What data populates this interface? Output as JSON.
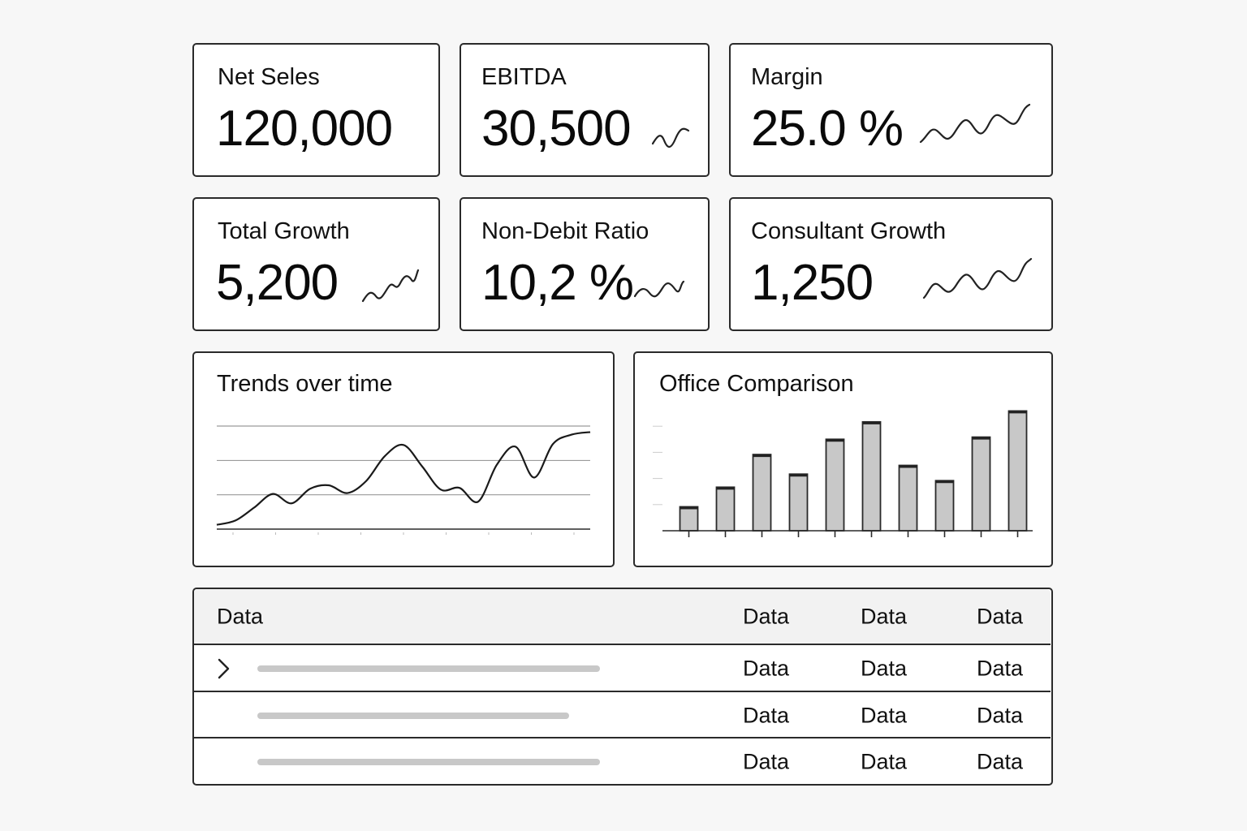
{
  "kpis": [
    {
      "label": "Net Seles",
      "value": "120,000",
      "sparkline": false
    },
    {
      "label": "EBITDA",
      "value": "30,500",
      "sparkline": true
    },
    {
      "label": "Margin",
      "value": "25.0 %",
      "sparkline": true
    },
    {
      "label": "Total Growth",
      "value": "5,200",
      "sparkline": true
    },
    {
      "label": "Non-Debit Ratio",
      "value": "10,2 %",
      "sparkline": true
    },
    {
      "label": "Consultant Growth",
      "value": "1,250",
      "sparkline": true
    }
  ],
  "panels": {
    "trends_title": "Trends over time",
    "office_title": "Office Comparison"
  },
  "chart_data": [
    {
      "type": "line",
      "title": "Trends over time",
      "x": [
        0,
        1,
        2,
        3,
        4,
        5,
        6,
        7,
        8,
        9,
        10,
        11,
        12,
        13,
        14,
        15,
        16,
        17,
        18,
        19,
        20
      ],
      "series": [
        {
          "values": [
            0.5,
            1.0,
            2.5,
            4.1,
            3.0,
            4.7,
            5.1,
            4.2,
            5.6,
            8.5,
            9.8,
            7.3,
            4.6,
            4.8,
            3.2,
            7.5,
            9.6,
            6.0,
            9.9,
            11.0,
            11.3
          ]
        }
      ],
      "ylim": [
        0,
        12
      ],
      "grid": true,
      "xlabel": "",
      "ylabel": ""
    },
    {
      "type": "bar",
      "title": "Office Comparison",
      "categories": [
        "",
        "",
        "",
        "",
        "",
        "",
        "",
        "",
        "",
        ""
      ],
      "values": [
        22,
        40,
        70,
        52,
        84,
        100,
        60,
        46,
        86,
        110
      ],
      "ylim": [
        0,
        120
      ],
      "bar_color": "#c8c8c8",
      "xlabel": "",
      "ylabel": ""
    }
  ],
  "table": {
    "headers": [
      "Data",
      "Data",
      "Data",
      "Data"
    ],
    "rows": [
      {
        "expandable": true,
        "bar_fraction": 1.0,
        "cells": [
          "Data",
          "Data",
          "Data"
        ]
      },
      {
        "expandable": false,
        "bar_fraction": 0.91,
        "cells": [
          "Data",
          "Data",
          "Data"
        ]
      },
      {
        "expandable": false,
        "bar_fraction": 1.0,
        "cells": [
          "Data",
          "Data",
          "Data"
        ]
      }
    ],
    "icons": {
      "expand": "chevron-right-icon"
    }
  },
  "colors": {
    "border": "#2a2a2a",
    "placeholder": "#c8c8c8",
    "gridline": "#9a9a9a"
  }
}
